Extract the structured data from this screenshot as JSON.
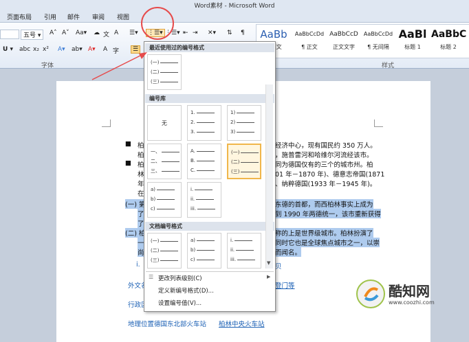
{
  "window": {
    "title": "Word素材 - Microsoft Word"
  },
  "tabs": [
    "页面布局",
    "引用",
    "邮件",
    "审阅",
    "视图"
  ],
  "ribbon": {
    "font_size": "五号",
    "font_group": "字体",
    "styles_group": "样式",
    "styles": [
      {
        "sample": "AaBb",
        "label": "¶ 正文"
      },
      {
        "sample": "AaBbCcDd",
        "label": "¶ 正文"
      },
      {
        "sample": "AaBbCcD",
        "label": "正文文字"
      },
      {
        "sample": "AaBbCcDd",
        "label": "¶ 无间隔"
      },
      {
        "sample": "AaBl",
        "label": "标题 1"
      },
      {
        "sample": "AaBbC",
        "label": "标题 2"
      }
    ]
  },
  "dropdown": {
    "recent_title": "最近使用过的编号格式",
    "library_title": "编号库",
    "doc_title": "文档编号格式",
    "none_label": "无",
    "recent": [
      [
        "(一)",
        "(二)",
        "(三)"
      ]
    ],
    "library": [
      [
        "1.",
        "2.",
        "3."
      ],
      [
        "1)",
        "2)",
        "3)"
      ],
      [
        "一、",
        "二、",
        "三、"
      ],
      [
        "A.",
        "B.",
        "C."
      ],
      [
        "(一)",
        "(二)",
        "(三)"
      ],
      [
        "a)",
        "b)",
        "c)"
      ],
      [
        "i.",
        "ii.",
        "iii."
      ]
    ],
    "document": [
      [
        "(一)",
        "(二)",
        "(三)"
      ],
      [
        "a)",
        "b)",
        "c)"
      ],
      [
        "i.",
        "ii.",
        "iii."
      ]
    ],
    "menu": [
      "更改列表级别(C)",
      "定义新编号格式(D)...",
      "设置编号值(V)..."
    ]
  },
  "document": {
    "lines": [
      {
        "text": "柏",
        "right": "经济中心，现有国民约 350 万人。"
      },
      {
        "text": "柏",
        "right": "，施普雷河和哈维尔河流经该市。"
      },
      {
        "text": "柏",
        "right": "同为德国仅有的三个的城市州。柏"
      },
      {
        "text": "林",
        "right": "01 年－1870 年)、德意志帝国(1871"
      },
      {
        "text": "年",
        "right": "、纳粹德国(1933 年－1945 年)。"
      },
      {
        "text": "在",
        "right": ""
      },
      {
        "text": "(一) 第",
        "right": "东德的首都，而西柏林事实上成为"
      },
      {
        "text": "了",
        "right": "到 1990 年两德统一，该市重新获得"
      },
      {
        "text": "了",
        "right": ""
      },
      {
        "text": "(二) 柏",
        "right": "称的上是世界级城市。柏林扮演了"
      },
      {
        "text": "一",
        "right": "同时它也是全球焦点城市之一，以崇"
      },
      {
        "text": "尚",
        "right": "而闻名。"
      },
      {
        "text": "i.",
        "right": "贝"
      },
      {
        "text": "外文名",
        "right": "登门等"
      },
      {
        "text": "行政区",
        "right": ""
      }
    ],
    "bottom_line": "地理位置德国东北部火车站",
    "bottom_link": "柏林中央火车站"
  },
  "logo": {
    "name": "酷知网",
    "url": "www.coozhi.com"
  }
}
